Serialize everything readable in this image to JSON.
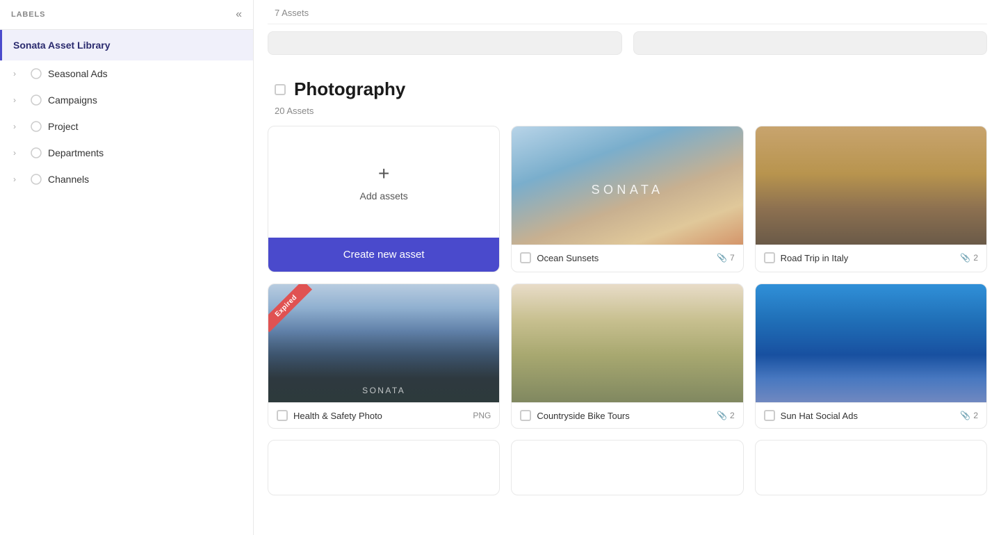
{
  "sidebar": {
    "header_label": "LABELS",
    "collapse_icon": "«",
    "library_name": "Sonata Asset Library",
    "items": [
      {
        "id": "seasonal-ads",
        "label": "Seasonal Ads",
        "has_chevron": true
      },
      {
        "id": "campaigns",
        "label": "Campaigns",
        "has_chevron": true
      },
      {
        "id": "project",
        "label": "Project",
        "has_chevron": true
      },
      {
        "id": "departments",
        "label": "Departments",
        "has_chevron": true
      },
      {
        "id": "channels",
        "label": "Channels",
        "has_chevron": true
      }
    ]
  },
  "top_section": {
    "assets_count": "7 Assets"
  },
  "photography_section": {
    "title": "Photography",
    "assets_count": "20 Assets",
    "add_assets_label": "Add assets",
    "create_new_asset_btn": "Create new asset"
  },
  "asset_cards": [
    {
      "id": "ocean-sunsets",
      "name": "Ocean Sunsets",
      "clip_count": "7",
      "img_class": "img-ocean",
      "expired": false,
      "tag": ""
    },
    {
      "id": "road-trip-italy",
      "name": "Road Trip in Italy",
      "clip_count": "2",
      "img_class": "img-roadtrip",
      "expired": false,
      "tag": ""
    },
    {
      "id": "health-safety",
      "name": "Health & Safety Photo",
      "clip_count": "",
      "img_class": "img-health",
      "expired": true,
      "tag": "PNG"
    },
    {
      "id": "countryside-bike",
      "name": "Countryside Bike Tours",
      "clip_count": "2",
      "img_class": "img-bike",
      "expired": false,
      "tag": ""
    },
    {
      "id": "sun-hat",
      "name": "Sun Hat Social Ads",
      "clip_count": "2",
      "img_class": "img-sunhat",
      "expired": false,
      "tag": ""
    }
  ],
  "ribbon_text": "Expired",
  "icons": {
    "chevron": "›",
    "collapse": "«",
    "plus": "+",
    "clip": "📎"
  }
}
